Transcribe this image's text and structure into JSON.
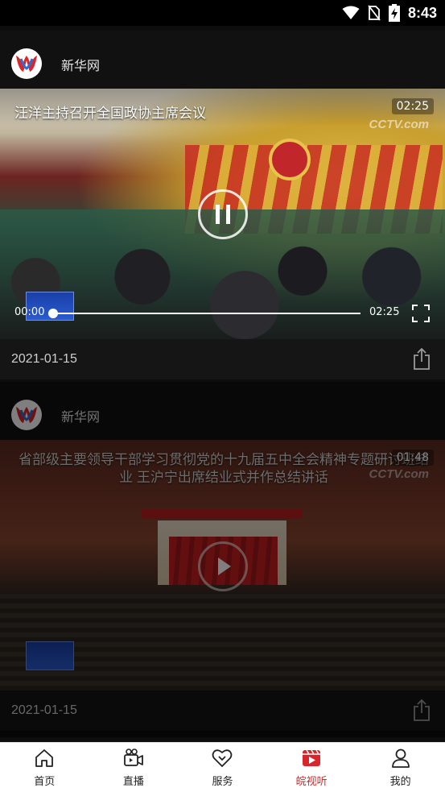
{
  "status_bar": {
    "time": "8:43"
  },
  "feed": {
    "cards": [
      {
        "source": "新华网",
        "title": "汪洋主持召开全国政协主席会议",
        "duration": "02:25",
        "watermark": "CCTV.com",
        "current_time": "00:00",
        "total_time": "02:25",
        "progress": 0.0,
        "date": "2021-01-15"
      },
      {
        "source": "新华网",
        "title": "省部级主要领导干部学习贯彻党的十九届五中全会精神专题研讨班结业 王沪宁出席结业式并作总结讲话",
        "duration": "01:48",
        "watermark": "CCTV.com",
        "date": "2021-01-15"
      }
    ]
  },
  "tabbar": {
    "active_color": "#d8262a",
    "items": [
      {
        "label": "首页",
        "icon": "home-icon"
      },
      {
        "label": "直播",
        "icon": "live-camera-icon"
      },
      {
        "label": "服务",
        "icon": "service-heart-icon"
      },
      {
        "label": "皖视听",
        "icon": "video-play-icon"
      },
      {
        "label": "我的",
        "icon": "user-icon"
      }
    ]
  }
}
